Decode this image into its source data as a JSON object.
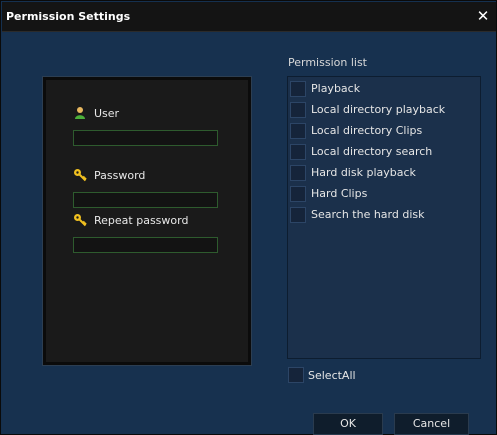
{
  "window": {
    "title": "Permission Settings",
    "close_symbol": "✕",
    "colors": {
      "titlebar": "#141414",
      "background": "#17314f",
      "panel": "#1a1a1a",
      "input_border": "#2e5b2e"
    }
  },
  "user_panel": {
    "user_label": "User",
    "user_value": "",
    "password_label": "Password",
    "password_value": "",
    "repeat_password_label": "Repeat password",
    "repeat_password_value": "",
    "icons": [
      "user-icon",
      "key-icon",
      "key-icon"
    ]
  },
  "permissions": {
    "title": "Permission list",
    "items": [
      {
        "label": "Playback",
        "checked": false
      },
      {
        "label": "Local directory playback",
        "checked": false
      },
      {
        "label": "Local directory Clips",
        "checked": false
      },
      {
        "label": "Local directory search",
        "checked": false
      },
      {
        "label": "Hard disk playback",
        "checked": false
      },
      {
        "label": "Hard Clips",
        "checked": false
      },
      {
        "label": "Search the hard disk",
        "checked": false
      }
    ],
    "select_all_label": "SelectAll",
    "select_all_checked": false
  },
  "buttons": {
    "ok_label": "OK",
    "cancel_label": "Cancel"
  }
}
